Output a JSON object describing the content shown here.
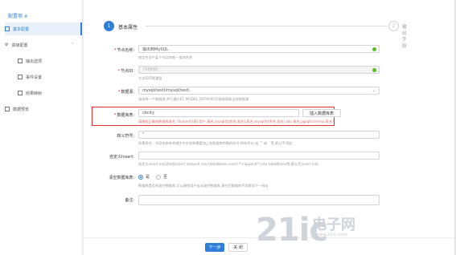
{
  "sidebar": {
    "header": "配置项",
    "items": [
      {
        "label": "基本配置"
      },
      {
        "label": "高级配置",
        "chevron": "⌃"
      },
      {
        "label": "输出选项"
      },
      {
        "label": "事件设置"
      },
      {
        "label": "结果映射"
      },
      {
        "label": "数据预览"
      }
    ]
  },
  "steps": [
    {
      "num": "1",
      "label": "基本属性"
    },
    {
      "num": "2",
      "label": "输出字段"
    }
  ],
  "form": {
    "node_name": {
      "label": "节点名称:",
      "value": "输出到MySQL",
      "hint": "指定任务中某个节点的唯一描述名称"
    },
    "node_id": {
      "label": "节点ID:",
      "value": "788888",
      "hint": "节点ID不能重复"
    },
    "datasource": {
      "label": "数据源:",
      "value": "mysql(test)/mysql(test)",
      "hint": "请选择一个数据源,并可通过ET_MODEL_DATASRCID直接获取当前数据源"
    },
    "table_name": {
      "label": "数据库表:",
      "value": "cbcity",
      "button": "插入数据库表",
      "hint": "请按照正确的数据库表名: Oracle为[表]:用户.表名,mysql为[库名.表名],表名,mysql为[库名.表名],sdu 表名,pgsql[schema.表名]"
    },
    "escape": {
      "label": "转义符号:",
      "value": "\"",
      "hint": "如果表名、字段名带有关键字中文名称需要加上各数据库特殊的符号:例如为口 或 \"\" 或 ` 等,默认不添加"
    },
    "custom_insert": {
      "label": "自定义Insert:",
      "hint": "如定义insert into语句如insert delayed into tableName,insert /*+append*/ into tableName等,默认为insert into"
    },
    "clear_table": {
      "label": "清空数据库表:",
      "options": [
        "是",
        "否"
      ],
      "hint": "数据库是否先清空数据库,可以避免用户自动清空数据库,清空后数据库不用再如下一样去"
    },
    "remark": {
      "label": "备注:"
    }
  },
  "buttons": {
    "next": "下一步",
    "close": "关 闭"
  },
  "watermark": {
    "brand": "21ic",
    "cn": "电子网",
    "url": "www.21ic.com"
  },
  "colors": {
    "accent": "#2f7fd8",
    "error": "#e03030",
    "success": "#52c41a"
  }
}
